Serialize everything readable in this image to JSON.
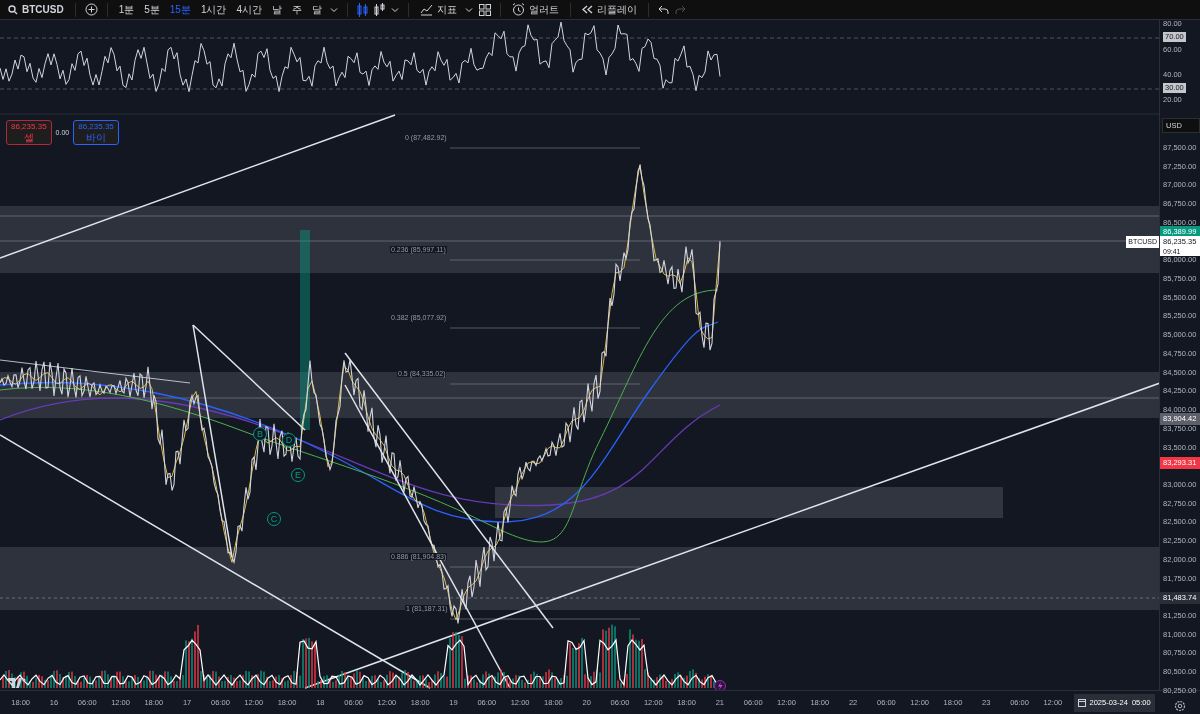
{
  "toolbar": {
    "symbol": "BTCUSD",
    "intervals": [
      {
        "label": "1분",
        "selected": false
      },
      {
        "label": "5분",
        "selected": false
      },
      {
        "label": "15분",
        "selected": true
      },
      {
        "label": "1시간",
        "selected": false
      },
      {
        "label": "4시간",
        "selected": false
      },
      {
        "label": "날",
        "selected": false
      },
      {
        "label": "주",
        "selected": false
      },
      {
        "label": "달",
        "selected": false
      }
    ],
    "indicators_label": "지표",
    "alert_label": "얼러트",
    "replay_label": "리플레이",
    "redo_disabled": true
  },
  "rsi_axis": [
    {
      "label": "80.00",
      "kind": "plain"
    },
    {
      "label": "70.00",
      "kind": "boxed"
    },
    {
      "label": "60.00",
      "kind": "plain"
    },
    {
      "label": "40.00",
      "kind": "plain"
    },
    {
      "label": "30.00",
      "kind": "boxed"
    },
    {
      "label": "20.00",
      "kind": "plain"
    }
  ],
  "order_panel": {
    "sell_price": "86,235.35",
    "sell_label": "셀",
    "spread": "0.00",
    "buy_price": "86,235.35",
    "buy_label": "바이"
  },
  "fib_levels": [
    "0 (87,482.92)",
    "0.236 (85,997.11)",
    "0.382 (85,077.92)",
    "0.5 (84,335.02)",
    "0.886 (81,904.83)",
    "1 (81,187.31)"
  ],
  "wave_labels": [
    "B",
    "D",
    "E",
    "C"
  ],
  "price_axis": {
    "currency": "USD",
    "labels": [
      "87,500.00",
      "87,250.00",
      "87,000.00",
      "86,750.00",
      "86,500.00",
      "86,000.00",
      "85,750.00",
      "85,500.00",
      "85,250.00",
      "85,000.00",
      "84,750.00",
      "84,500.00",
      "84,250.00",
      "84,000.00",
      "83,750.00",
      "83,500.00",
      "83,000.00",
      "82,750.00",
      "82,500.00",
      "82,250.00",
      "82,000.00",
      "81,750.00",
      "81,250.00",
      "81,000.00",
      "80,750.00",
      "80,500.00",
      "80,250.00"
    ]
  },
  "price_tags": [
    {
      "kind": "high",
      "label": "86,389.99"
    },
    {
      "kind": "last",
      "symbol": "BTCUSD",
      "label": "86,235.35",
      "countdown": "09:41"
    },
    {
      "kind": "level",
      "label": "83,904.42"
    },
    {
      "kind": "low",
      "label": "83,293.31"
    },
    {
      "kind": "line",
      "label": "81,483.74"
    }
  ],
  "time_axis": {
    "labels": [
      "18:00",
      "16",
      "06:00",
      "12:00",
      "18:00",
      "17",
      "06:00",
      "12:00",
      "18:00",
      "18",
      "06:00",
      "12:00",
      "18:00",
      "19",
      "06:00",
      "12:00",
      "18:00",
      "20",
      "06:00",
      "12:00",
      "18:00",
      "21",
      "06:00",
      "12:00",
      "18:00",
      "22",
      "06:00",
      "12:00",
      "18:00",
      "23",
      "06:00",
      "12:00"
    ],
    "cursor_date": "2025-03-24",
    "cursor_time": "05:00"
  }
}
